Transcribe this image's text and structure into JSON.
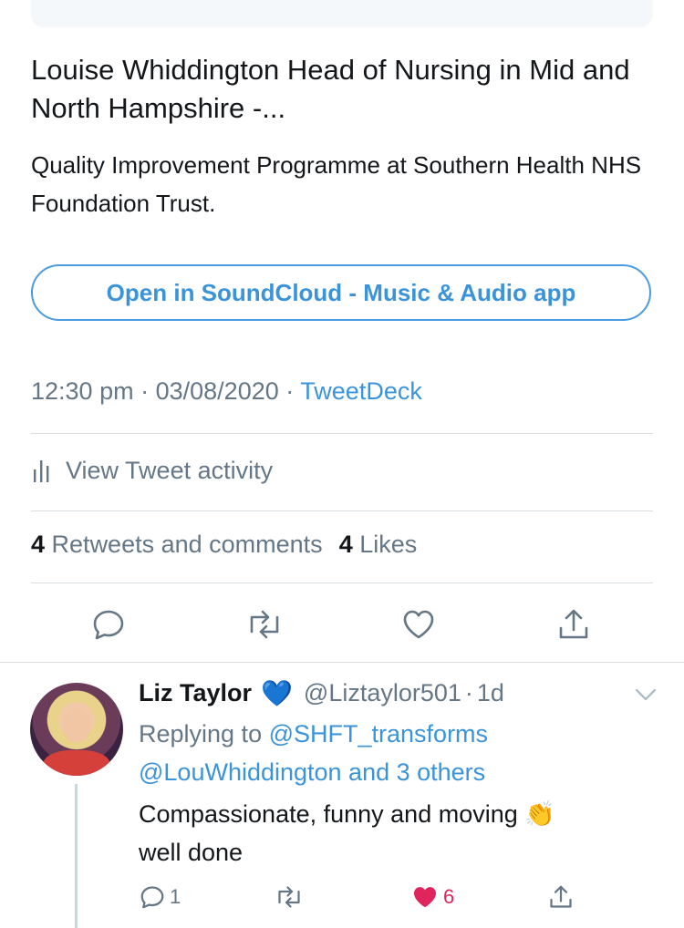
{
  "card": {
    "title": "Louise Whiddington Head of Nursing in Mid and North Hampshire -...",
    "description": "Quality Improvement Programme at Southern Health NHS Foundation Trust.",
    "open_button": "Open in SoundCloud - Music & Audio app"
  },
  "meta": {
    "time": "12:30 pm",
    "date": "03/08/2020",
    "separator": "·",
    "source": "TweetDeck"
  },
  "activity": {
    "label": "View Tweet activity",
    "icon": "bar-chart-icon"
  },
  "stats": {
    "retweets_count": "4",
    "retweets_label": "Retweets and comments",
    "likes_count": "4",
    "likes_label": "Likes"
  },
  "actions": [
    {
      "icon": "reply-icon"
    },
    {
      "icon": "retweet-icon"
    },
    {
      "icon": "like-icon"
    },
    {
      "icon": "share-icon"
    }
  ],
  "reply": {
    "name": "Liz Taylor",
    "badge": "💙",
    "handle": "@Liztaylor501",
    "dot": "·",
    "time": "1d",
    "replying_prefix": "Replying to",
    "mention1": "@SHFT_transforms",
    "mention2": "@LouWhiddington and 3 others",
    "text_line1": "Compassionate, funny and moving",
    "emoji": "👏",
    "text_line2": "well done",
    "reply_count": "1",
    "like_count": "6",
    "colors": {
      "accent": "#3b94d9",
      "like": "#e0245e",
      "muted": "#657786"
    }
  }
}
